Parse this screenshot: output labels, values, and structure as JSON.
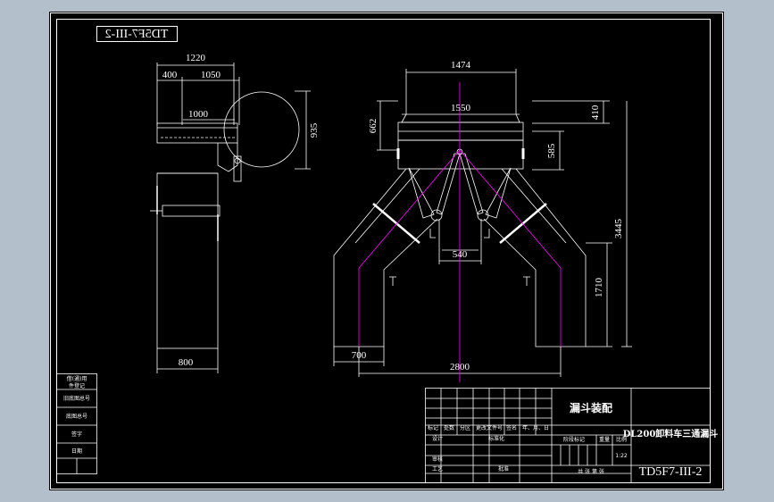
{
  "drawing": {
    "mirrored_code": "TD5F7-III-2",
    "code": "TD5F7-III-2",
    "title": "漏斗装配",
    "project": "DL200卸料车三通漏斗",
    "scale": "1:22"
  },
  "side_view": {
    "dims": {
      "d1220": "1220",
      "d400": "400",
      "d1050": "1050",
      "d1000": "1000",
      "d935": "935",
      "d800": "800"
    }
  },
  "front_view": {
    "dims": {
      "d1474": "1474",
      "d1550": "1550",
      "d662": "662",
      "d410": "410",
      "d585": "585",
      "d3445": "3445",
      "d540": "540",
      "d1710": "1710",
      "d700": "700",
      "d2800": "2800"
    }
  },
  "title_block": {
    "left_labels": [
      "借(通)用",
      "件登记",
      "旧底图总号",
      "底图总号",
      "签字",
      "日期"
    ],
    "headers": [
      "标记",
      "处数",
      "分区",
      "更改文件号",
      "签名",
      "年、月、日"
    ],
    "stage_header": "阶段标记",
    "weight_header": "重量",
    "scale_header": "比例",
    "design": "设计",
    "standardization": "标准化",
    "check": "审核",
    "process": "工艺",
    "approve": "批准",
    "sheets": "共 张 第 张"
  },
  "colors": {
    "background": "#b4bfcc",
    "sheet": "#000000",
    "line": "#ffffff",
    "centerline": "#ff00ff"
  }
}
